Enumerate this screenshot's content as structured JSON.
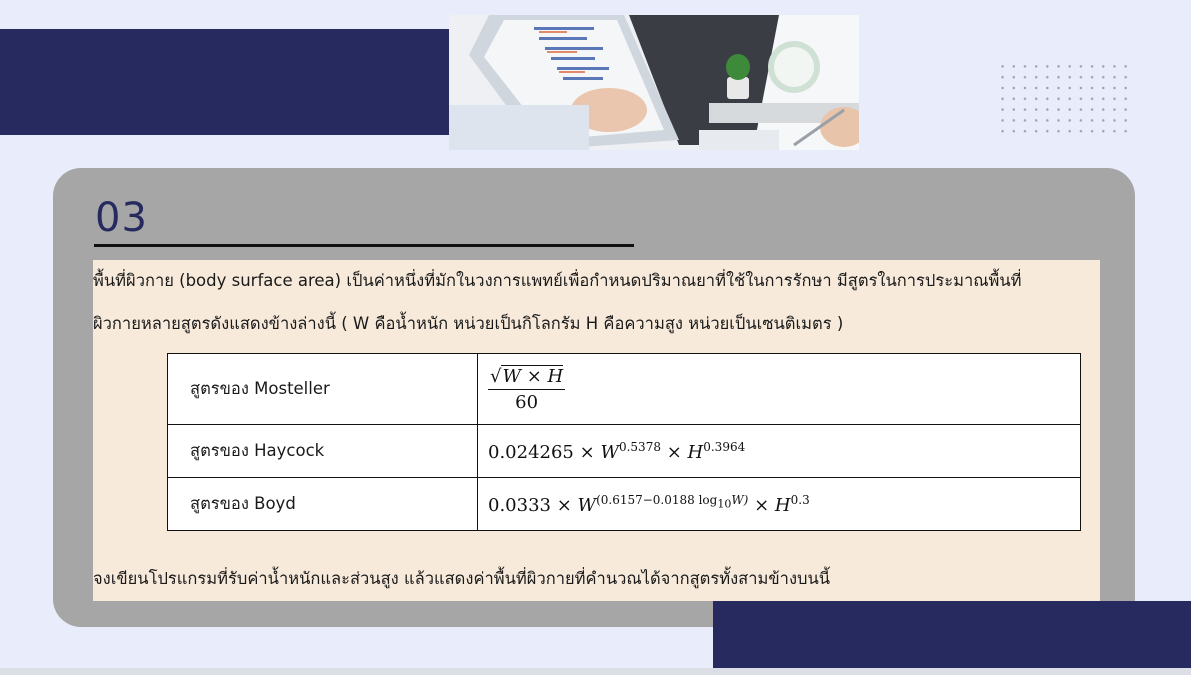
{
  "slide": {
    "number": "03"
  },
  "document": {
    "paragraph_1": "พื้นที่ผิวกาย (body surface area) เป็นค่าหนึ่งที่มักในวงการแพทย์เพื่อกำหนดปริมาณยาที่ใช้ในการรักษา มีสูตรในการประมาณพื้นที่",
    "paragraph_2": "ผิวกายหลายสูตรดังแสดงข้างล่างนี้ ( W คือน้ำหนัก หน่วยเป็นกิโลกรัม  H คือความสูง หน่วยเป็นเซนติเมตร )",
    "paragraph_3": "จงเขียนโปรแกรมที่รับค่าน้ำหนักและส่วนสูง แล้วแสดงค่าพื้นที่ผิวกายที่คำนวณได้จากสูตรทั้งสามข้างบนนี้",
    "formulas": [
      {
        "name": "สูตรของ Mosteller",
        "numerator": "W × H",
        "denominator": "60"
      },
      {
        "name": "สูตรของ Haycock",
        "coef": "0.024265",
        "w_exp": "0.5378",
        "h_exp": "0.3964"
      },
      {
        "name": "สูตรของ Boyd",
        "coef": "0.0333",
        "w_exp_a": "(0.6157−0.0188 log",
        "w_exp_sub": "10",
        "w_exp_b": "W)",
        "h_exp": "0.3"
      }
    ]
  },
  "symbols": {
    "times": "×",
    "W": "W",
    "H": "H",
    "sqrt": "√"
  },
  "colors": {
    "navy": "#262a5e",
    "background": "#e9edfb",
    "card": "#a6a6a6",
    "document": "#f7eadb"
  },
  "photo": {
    "icon": "business-chart-photo"
  }
}
